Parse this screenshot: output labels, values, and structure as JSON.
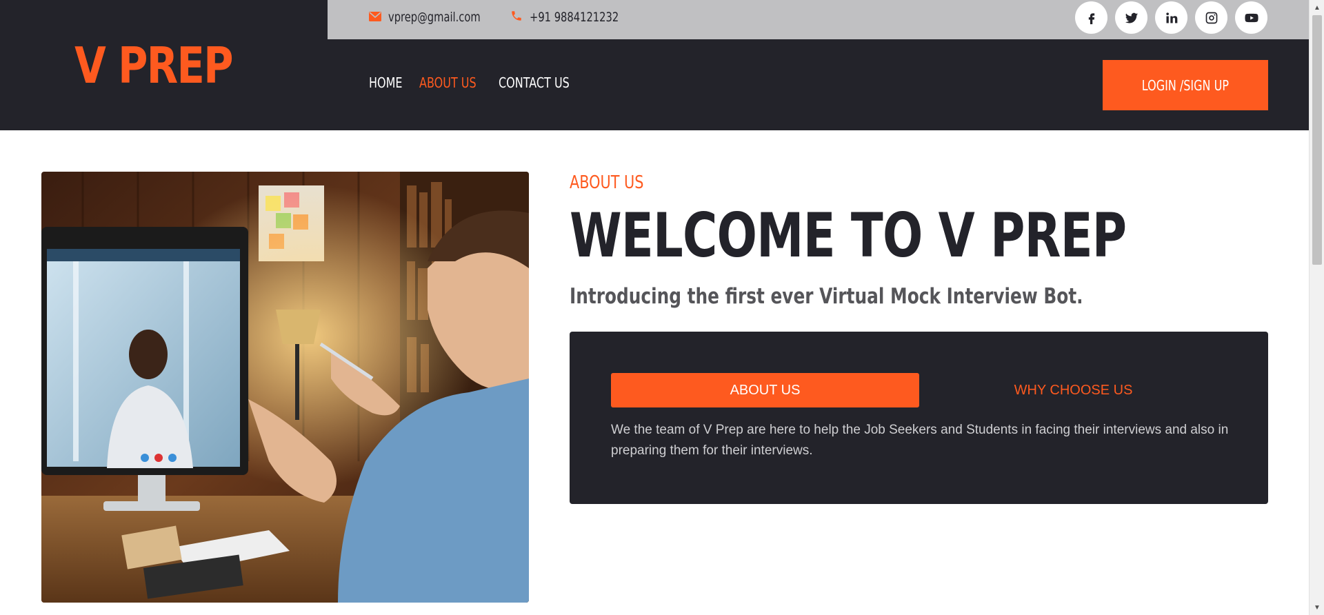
{
  "brand": {
    "name": "V PREP",
    "accent_color": "#fe5a1f",
    "dark_color": "#23232a"
  },
  "topbar": {
    "email": {
      "icon": "envelope-icon",
      "text": "vprep@gmail.com"
    },
    "phone": {
      "icon": "phone-icon",
      "text": "+91 9884121232"
    },
    "socials": [
      {
        "name": "facebook",
        "icon": "facebook-icon"
      },
      {
        "name": "twitter",
        "icon": "twitter-icon"
      },
      {
        "name": "linkedin",
        "icon": "linkedin-icon"
      },
      {
        "name": "instagram",
        "icon": "instagram-icon"
      },
      {
        "name": "youtube",
        "icon": "youtube-icon"
      }
    ]
  },
  "nav": {
    "items": [
      {
        "label": "HOME",
        "active": false
      },
      {
        "label": "ABOUT US",
        "active": true
      },
      {
        "label": "CONTACT US",
        "active": false
      }
    ],
    "login_label": "LOGIN /SIGN UP"
  },
  "about": {
    "eyebrow": "ABOUT US",
    "headline": "WELCOME TO V PREP",
    "subhead": "Introducing the first ever Virtual Mock Interview Bot.",
    "tabs": [
      {
        "label": "ABOUT US",
        "active": true
      },
      {
        "label": "WHY CHOOSE US",
        "active": false
      }
    ],
    "body": "We the team of V Prep are here to help the Job Seekers and Students in facing their interviews and also in preparing them for their interviews."
  }
}
